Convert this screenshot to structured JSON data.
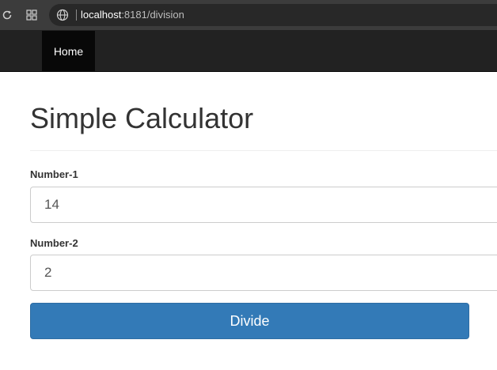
{
  "browser": {
    "url_host": "localhost",
    "url_rest": ":8181/division"
  },
  "navbar": {
    "home_label": "Home"
  },
  "main": {
    "title": "Simple Calculator",
    "number1": {
      "label": "Number-1",
      "value": "14"
    },
    "number2": {
      "label": "Number-2",
      "value": "2"
    },
    "divide_label": "Divide"
  },
  "colors": {
    "navbar_bg": "#222222",
    "active_nav_bg": "#080808",
    "button_primary": "#337ab7"
  }
}
